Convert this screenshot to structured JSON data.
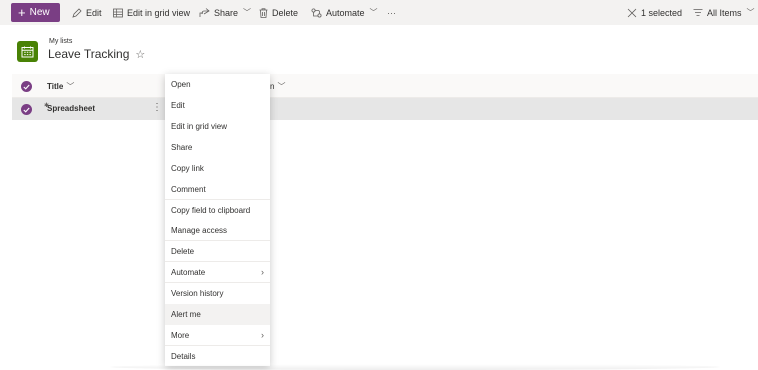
{
  "commandbar": {
    "new_label": "New",
    "edit_label": "Edit",
    "grid_label": "Edit in grid view",
    "share_label": "Share",
    "delete_label": "Delete",
    "automate_label": "Automate",
    "overflow": "···",
    "selected_label": "1 selected",
    "view_label": "All Items"
  },
  "header": {
    "breadcrumb": "My lists",
    "title": "Leave Tracking"
  },
  "grid": {
    "title_column": "Title",
    "second_column_fragment": "n",
    "rows": [
      {
        "title": "Spreadsheet"
      }
    ]
  },
  "menu": {
    "items": [
      "Open",
      "Edit",
      "Edit in grid view",
      "Share",
      "Copy link",
      "Comment",
      "Copy field to clipboard",
      "Manage access",
      "Delete",
      "Automate",
      "Version history",
      "Alert me",
      "More",
      "Details"
    ]
  },
  "colors": {
    "accent": "#7a3e84",
    "list_icon": "#498205"
  }
}
